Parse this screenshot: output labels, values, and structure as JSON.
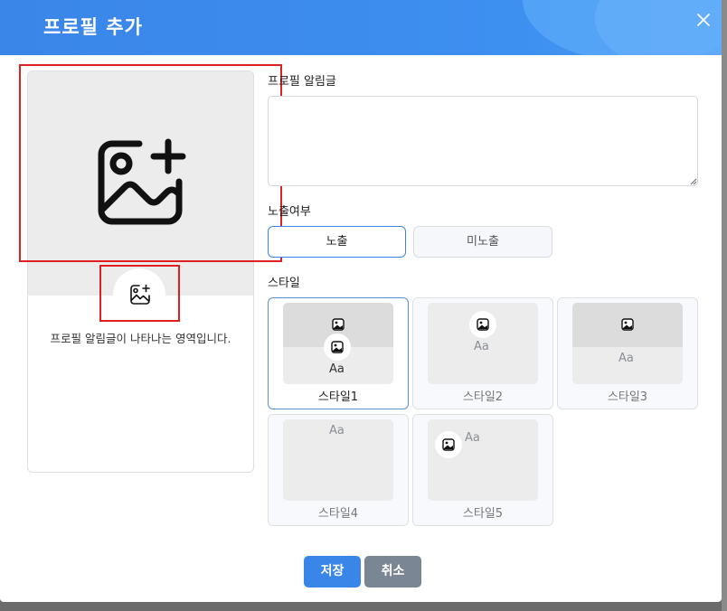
{
  "header": {
    "title": "프로필 추가",
    "close_icon": "close-icon"
  },
  "preview": {
    "description": "프로필 알림글이 나타나는 영역입니다.",
    "placeholder_icon": "image-add-icon"
  },
  "form": {
    "notice_label": "프로필 알림글",
    "notice_value": "",
    "visibility_label": "노출여부",
    "visibility_options": [
      "노출",
      "미노출"
    ],
    "visibility_selected": "노출",
    "style_label": "스타일",
    "styles": [
      {
        "name": "스타일1",
        "aa": "Aa"
      },
      {
        "name": "스타일2",
        "aa": "Aa"
      },
      {
        "name": "스타일3",
        "aa": "Aa"
      },
      {
        "name": "스타일4",
        "aa": "Aa"
      },
      {
        "name": "스타일5",
        "aa": "Aa"
      }
    ],
    "selected_style": "스타일1"
  },
  "footer": {
    "save_label": "저장",
    "cancel_label": "취소"
  },
  "colors": {
    "accent": "#3a86e8",
    "highlight": "#e02020",
    "cancel": "#7b8694"
  }
}
